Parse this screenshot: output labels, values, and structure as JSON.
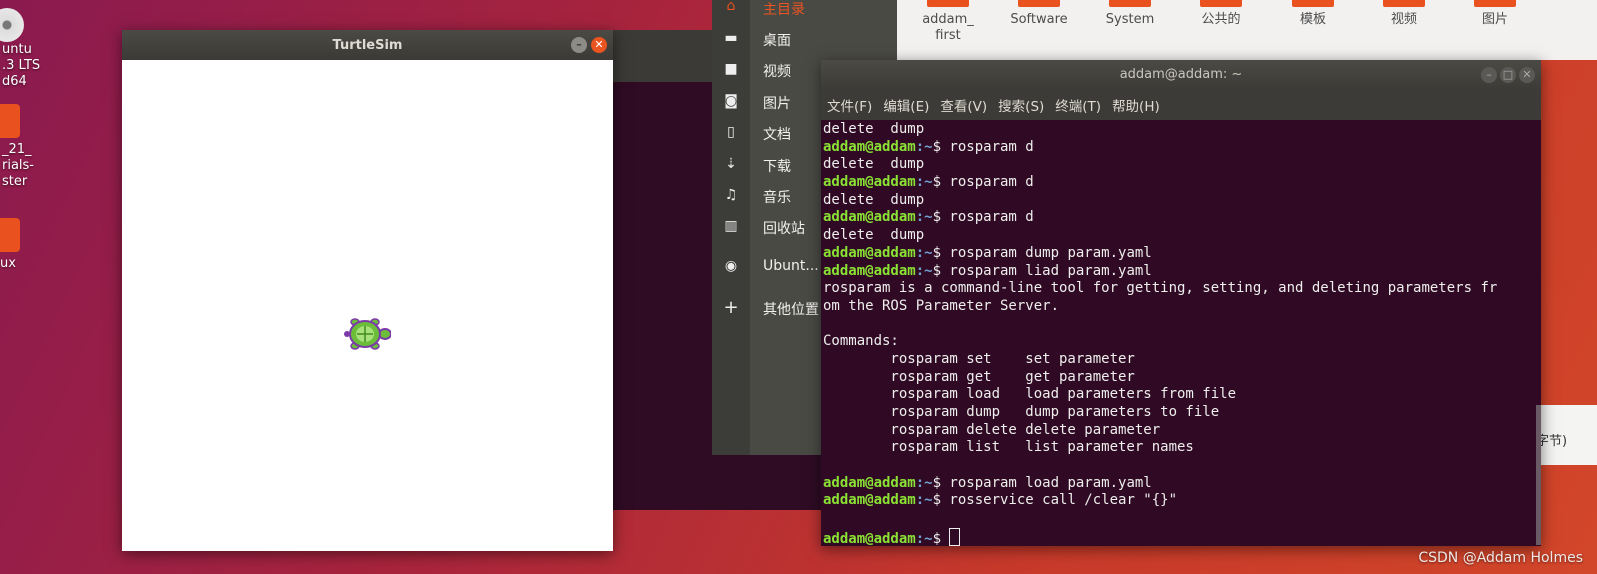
{
  "desktop": {
    "icons": [
      {
        "label_lines": [
          "untu",
          ".3 LTS",
          "d64"
        ],
        "icon": "dvd-icon"
      },
      {
        "label_lines": [
          "_21_",
          "rials-",
          "ster"
        ],
        "icon": "folder-icon"
      },
      {
        "label_lines": [
          "ux"
        ],
        "icon": "folder-icon"
      }
    ]
  },
  "turtlesim": {
    "title": "TurtleSim"
  },
  "file_manager": {
    "sidebar": [
      {
        "icon": "home-icon",
        "label": "主目录",
        "active": true
      },
      {
        "icon": "folder-icon",
        "label": "桌面"
      },
      {
        "icon": "video-icon",
        "label": "视频"
      },
      {
        "icon": "camera-icon",
        "label": "图片"
      },
      {
        "icon": "document-icon",
        "label": "文档"
      },
      {
        "icon": "download-icon",
        "label": "下载"
      },
      {
        "icon": "music-icon",
        "label": "音乐"
      },
      {
        "icon": "trash-icon",
        "label": "回收站"
      },
      {
        "icon": "disc-icon",
        "label": "Ubunt..."
      },
      {
        "icon": "plus-icon",
        "label": "其他位置"
      }
    ],
    "folders": [
      {
        "label": "addam_\nfirst"
      },
      {
        "label": "Software"
      },
      {
        "label": "System"
      },
      {
        "label": "公共的"
      },
      {
        "label": "模板"
      },
      {
        "label": "视频"
      },
      {
        "label": "图片"
      }
    ],
    "edge_text": "字节)"
  },
  "terminal": {
    "title": "addam@addam: ~",
    "menu": [
      "文件(F)",
      "编辑(E)",
      "查看(V)",
      "搜索(S)",
      "终端(T)",
      "帮助(H)"
    ],
    "prompt_user": "addam@addam",
    "prompt_path": ":~",
    "lines": [
      {
        "text": "delete  dump"
      },
      {
        "prompt": true,
        "cmd": "rosparam d"
      },
      {
        "text": "delete  dump"
      },
      {
        "prompt": true,
        "cmd": "rosparam d"
      },
      {
        "text": "delete  dump"
      },
      {
        "prompt": true,
        "cmd": "rosparam d"
      },
      {
        "text": "delete  dump"
      },
      {
        "prompt": true,
        "cmd": "rosparam dump param.yaml"
      },
      {
        "prompt": true,
        "cmd": "rosparam liad param.yaml"
      },
      {
        "text": "rosparam is a command-line tool for getting, setting, and deleting parameters fr"
      },
      {
        "text": "om the ROS Parameter Server."
      },
      {
        "text": ""
      },
      {
        "text": "Commands:"
      },
      {
        "text": "        rosparam set    set parameter"
      },
      {
        "text": "        rosparam get    get parameter"
      },
      {
        "text": "        rosparam load   load parameters from file"
      },
      {
        "text": "        rosparam dump   dump parameters to file"
      },
      {
        "text": "        rosparam delete delete parameter"
      },
      {
        "text": "        rosparam list   list parameter names"
      },
      {
        "text": ""
      },
      {
        "prompt": true,
        "cmd": "rosparam load param.yaml"
      },
      {
        "prompt": true,
        "cmd": "rosservice call /clear \"{}\""
      },
      {
        "text": ""
      },
      {
        "prompt": true,
        "cmd": "",
        "cursor": true
      }
    ]
  },
  "watermark": "CSDN @Addam Holmes"
}
